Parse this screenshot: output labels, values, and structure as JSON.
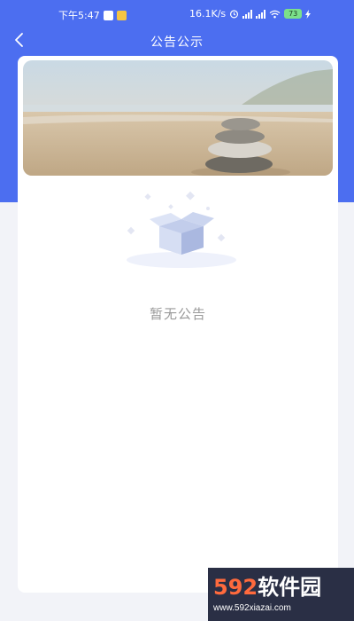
{
  "status_bar": {
    "time": "下午5:47",
    "network_speed": "16.1K/s",
    "battery_level": "73"
  },
  "nav": {
    "title": "公告公示",
    "back_icon": "chevron-left-icon"
  },
  "banner": {
    "description_icon": "stacked-stones-beach-image"
  },
  "empty_state": {
    "icon": "empty-box-icon",
    "message": "暂无公告"
  },
  "watermark": {
    "brand_num": "592",
    "brand_cn": "软件园",
    "url": "www.592xiazai.com"
  },
  "colors": {
    "header": "#4c6ef0",
    "background": "#f2f3f8",
    "empty_text": "#9a9a9a"
  }
}
